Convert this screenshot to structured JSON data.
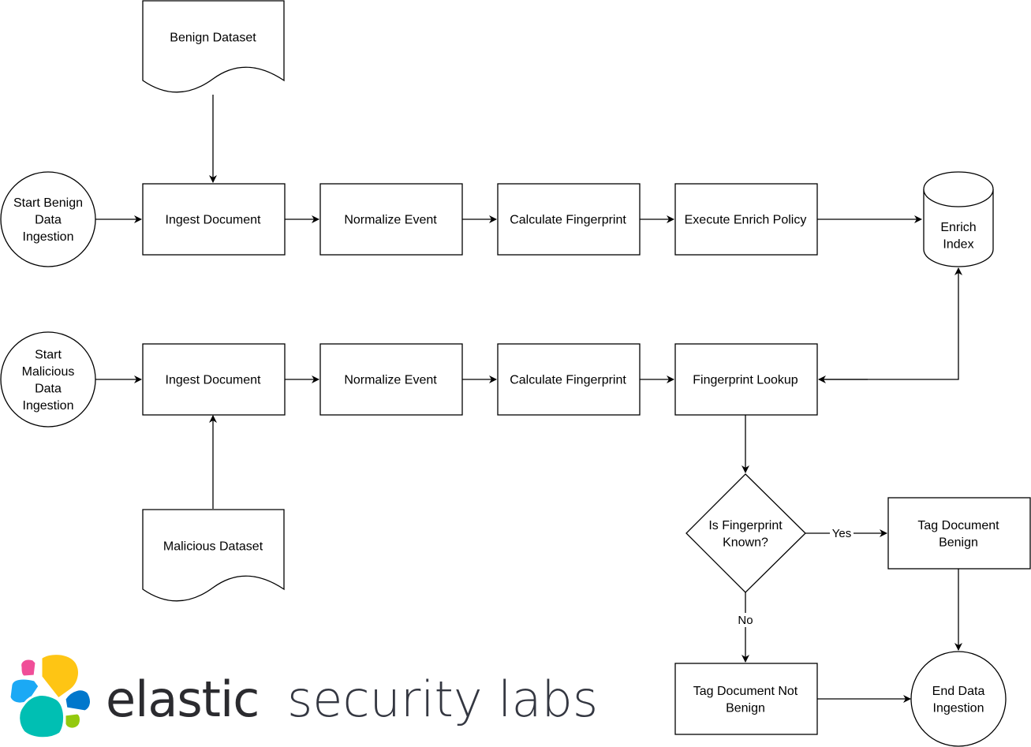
{
  "nodes": {
    "start_benign": [
      "Start Benign",
      "Data",
      "Ingestion"
    ],
    "benign_dataset": [
      "Benign Dataset"
    ],
    "ingest_1": [
      "Ingest Document"
    ],
    "normalize_1": [
      "Normalize Event"
    ],
    "fingerprint_1": [
      "Calculate Fingerprint"
    ],
    "enrich_policy": [
      "Execute Enrich Policy"
    ],
    "enrich_index": [
      "Enrich",
      "Index"
    ],
    "start_malicious": [
      "Start",
      "Malicious",
      "Data",
      "Ingestion"
    ],
    "ingest_2": [
      "Ingest Document"
    ],
    "normalize_2": [
      "Normalize Event"
    ],
    "fingerprint_2": [
      "Calculate Fingerprint"
    ],
    "fingerprint_lookup": [
      "Fingerprint Lookup"
    ],
    "malicious_dataset": [
      "Malicious Dataset"
    ],
    "decision": [
      "Is Fingerprint",
      "Known?"
    ],
    "tag_benign": [
      "Tag Document",
      "Benign"
    ],
    "tag_not_benign": [
      "Tag Document Not",
      "Benign"
    ],
    "end": [
      "End Data",
      "Ingestion"
    ]
  },
  "edge_labels": {
    "yes": "Yes",
    "no": "No"
  },
  "logo": {
    "brand": "elastic",
    "product": "security labs",
    "colors": {
      "pink": "#F04E98",
      "yellow": "#FEC514",
      "light_blue": "#1BA9F5",
      "teal": "#00BFB3",
      "blue": "#0077CC",
      "green": "#93C90E"
    }
  }
}
